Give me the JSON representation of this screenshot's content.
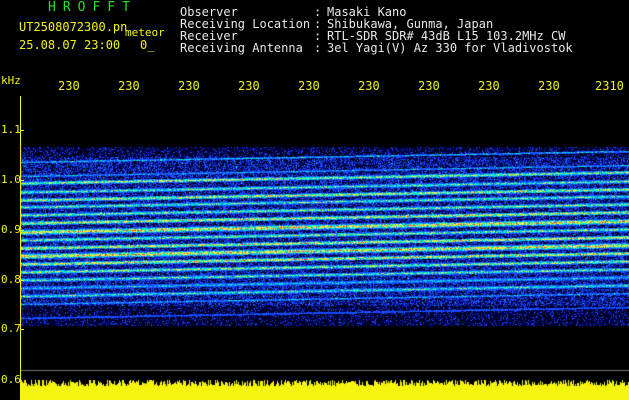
{
  "header": {
    "app_title": "HROFFT",
    "filename": "UT2508072300.pn",
    "mode": "meteor",
    "datetime": "25.08.07 23:00",
    "counter": "0_"
  },
  "info": [
    {
      "label": "Observer",
      "value": "Masaki Kano"
    },
    {
      "label": "Receiving Location",
      "value": "Shibukawa, Gunma, Japan"
    },
    {
      "label": "Receiver",
      "value": "RTL-SDR SDR# 43dB L15 103.2MHz CW"
    },
    {
      "label": "Receiving Antenna",
      "value": "3el Yagi(V) Az 330 for Vladivostok"
    }
  ],
  "axis": {
    "unit": "kHz",
    "time_ticks": [
      "230",
      "230",
      "230",
      "230",
      "230",
      "230",
      "230",
      "230",
      "230",
      "2310"
    ],
    "freq_labels": [
      "1.1",
      "1.0",
      "0.9",
      "0.8",
      "0.7",
      "0.6"
    ]
  },
  "colors": {
    "text_primary": "#f4f40c",
    "text_secondary": "#e8e8e8",
    "title": "#22e02a",
    "background": "#000000",
    "spectrum_low": "#00007a",
    "spectrum_mid": "#1e5cff",
    "spectrum_high": "#00e0d0",
    "spectrum_peak": "#ff3030",
    "power_bar": "#f4f40c"
  }
}
